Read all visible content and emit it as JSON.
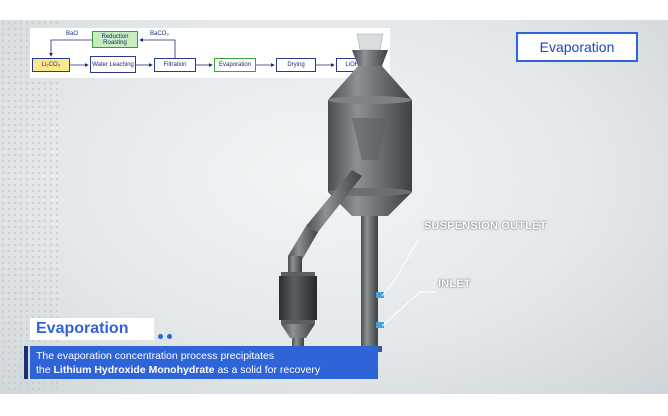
{
  "flowchart": {
    "boxes": {
      "reduction_roasting": "Reduction Roasting",
      "li2co3": "Li₂CO₃",
      "water_leaching": "Water Leaching",
      "filtration": "Filtration",
      "evaporation": "Evaporation",
      "drying": "Drying",
      "lioh": "LiOH·H₂O"
    },
    "labels": {
      "bao": "BaO",
      "baco3": "BaCO₃"
    }
  },
  "title_box": "Evaporation",
  "callouts": {
    "suspension_outlet": "SUSPENSION OUTLET",
    "inlet": "INLET"
  },
  "caption": {
    "heading": "Evaporation",
    "line1": "The evaporation concentration process precipitates",
    "line2_prefix": "the ",
    "line2_bold": "Lithium Hydroxide Monohydrate",
    "line2_suffix": " as a solid for recovery"
  },
  "colors": {
    "accent": "#2f63d8",
    "highlight_green": "#3aa636",
    "yellow_box": "#fbe88a"
  }
}
